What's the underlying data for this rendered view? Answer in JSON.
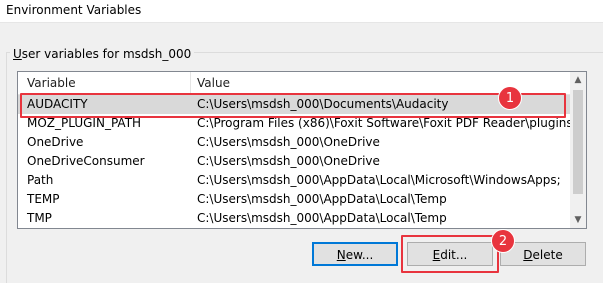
{
  "window": {
    "title": "Environment Variables"
  },
  "group": {
    "label_underline": "U",
    "label_rest": "ser variables for msdsh_000"
  },
  "list": {
    "columns": [
      "Variable",
      "Value"
    ],
    "rows": [
      {
        "name": "AUDACITY",
        "value": "C:\\Users\\msdsh_000\\Documents\\Audacity",
        "selected": true
      },
      {
        "name": "MOZ_PLUGIN_PATH",
        "value": "C:\\Program Files (x86)\\Foxit Software\\Foxit PDF Reader\\plugins\\"
      },
      {
        "name": "OneDrive",
        "value": "C:\\Users\\msdsh_000\\OneDrive"
      },
      {
        "name": "OneDriveConsumer",
        "value": "C:\\Users\\msdsh_000\\OneDrive"
      },
      {
        "name": "Path",
        "value": "C:\\Users\\msdsh_000\\AppData\\Local\\Microsoft\\WindowsApps;"
      },
      {
        "name": "TEMP",
        "value": "C:\\Users\\msdsh_000\\AppData\\Local\\Temp"
      },
      {
        "name": "TMP",
        "value": "C:\\Users\\msdsh_000\\AppData\\Local\\Temp"
      }
    ]
  },
  "buttons": {
    "new": {
      "underline": "N",
      "rest": "ew..."
    },
    "edit": {
      "underline": "E",
      "rest": "dit..."
    },
    "delete": {
      "underline": "D",
      "rest": "elete"
    }
  },
  "annotations": {
    "badge_1": "1",
    "badge_2": "2"
  },
  "colors": {
    "annotation": "#e8343e",
    "selected_row": "#d9d9d9",
    "accent": "#0078d7"
  },
  "icons": {
    "scroll_up": "chevron-up-icon",
    "scroll_down": "chevron-down-icon"
  }
}
